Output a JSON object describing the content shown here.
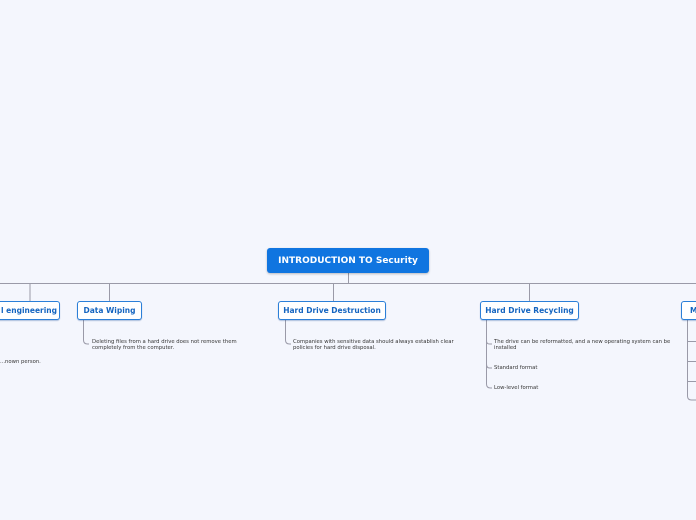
{
  "root": {
    "label": "INTRODUCTION TO Security"
  },
  "branches": [
    {
      "label": "Social engineering",
      "partial_label": "l engineering",
      "leaves": [
        "...nown person."
      ]
    },
    {
      "label": "Data Wiping",
      "leaves": [
        "Deleting files from a hard drive does not remove them completely from the computer."
      ]
    },
    {
      "label": "Hard Drive Destruction",
      "leaves": [
        "Companies with sensitive data should always establish clear policies for hard drive disposal."
      ]
    },
    {
      "label": "Hard Drive Recycling",
      "leaves": [
        "The drive can be reformatted, and a new operating system can be installed",
        "Standard format",
        "Low-level format"
      ]
    },
    {
      "label": "M",
      "leaves": []
    }
  ],
  "colors": {
    "root_bg": "#1075e0",
    "branch_border": "#2b7fd8",
    "branch_text": "#1565c0",
    "line": "#9a9aa8",
    "background": "#f4f6fd"
  }
}
